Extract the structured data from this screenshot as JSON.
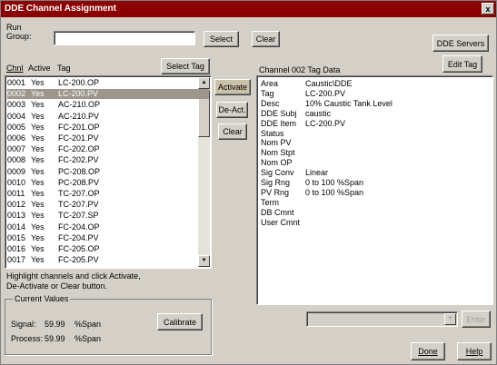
{
  "window": {
    "title": "DDE Channel Assignment",
    "close_glyph": "x"
  },
  "top": {
    "run_group_label_1": "Run",
    "run_group_label_2": "Group:",
    "run_group_value": "",
    "select_button": "Select",
    "clear_button": "Clear",
    "dde_servers_button": "DDE Servers",
    "edit_tag_button": "Edit Tag"
  },
  "channels": {
    "headers": {
      "chnl": "Chnl",
      "active": "Active",
      "tag": "Tag"
    },
    "select_tag_button": "Select Tag",
    "rows": [
      {
        "chnl": "0001",
        "active": "Yes",
        "tag": "LC-200.OP"
      },
      {
        "chnl": "0002",
        "active": "Yes",
        "tag": "LC-200.PV"
      },
      {
        "chnl": "0003",
        "active": "Yes",
        "tag": "AC-210.OP"
      },
      {
        "chnl": "0004",
        "active": "Yes",
        "tag": "AC-210.PV"
      },
      {
        "chnl": "0005",
        "active": "Yes",
        "tag": "FC-201.OP"
      },
      {
        "chnl": "0006",
        "active": "Yes",
        "tag": "FC-201.PV"
      },
      {
        "chnl": "0007",
        "active": "Yes",
        "tag": "FC-202.OP"
      },
      {
        "chnl": "0008",
        "active": "Yes",
        "tag": "FC-202.PV"
      },
      {
        "chnl": "0009",
        "active": "Yes",
        "tag": "PC-208.OP"
      },
      {
        "chnl": "0010",
        "active": "Yes",
        "tag": "PC-208.PV"
      },
      {
        "chnl": "0011",
        "active": "Yes",
        "tag": "TC-207.OP"
      },
      {
        "chnl": "0012",
        "active": "Yes",
        "tag": "TC-207.PV"
      },
      {
        "chnl": "0013",
        "active": "Yes",
        "tag": "TC-207.SP"
      },
      {
        "chnl": "0014",
        "active": "Yes",
        "tag": "FC-204.OP"
      },
      {
        "chnl": "0015",
        "active": "Yes",
        "tag": "FC-204.PV"
      },
      {
        "chnl": "0016",
        "active": "Yes",
        "tag": "FC-205.OP"
      },
      {
        "chnl": "0017",
        "active": "Yes",
        "tag": "FC-205.PV"
      }
    ],
    "selected_chnl": "0002",
    "hint_line_1": "Highlight channels and click Activate,",
    "hint_line_2": "De-Activate or Clear button."
  },
  "actions": {
    "activate": "Activate",
    "deactivate": "De-Act.",
    "clear": "Clear"
  },
  "current_values": {
    "title": "Current Values",
    "signal_label": "Signal:",
    "signal_value": "59.99",
    "signal_unit": "%Span",
    "process_label": "Process:",
    "process_value": "59.99",
    "process_unit": "%Span",
    "calibrate_button": "Calibrate"
  },
  "tag_data": {
    "title": "Channel 002 Tag Data",
    "fields": [
      {
        "key": "Area",
        "value": "Caustic\\DDE"
      },
      {
        "key": "Tag",
        "value": "LC-200.PV"
      },
      {
        "key": "Desc",
        "value": "10% Caustic Tank Level"
      },
      {
        "key": "DDE Subj",
        "value": "caustic"
      },
      {
        "key": "DDE Item",
        "value": "LC-200.PV"
      },
      {
        "key": "Status",
        "value": ""
      },
      {
        "key": "Nom PV",
        "value": ""
      },
      {
        "key": "Nom Stpt",
        "value": ""
      },
      {
        "key": "Nom OP",
        "value": ""
      },
      {
        "key": "Sig Conv",
        "value": "Linear"
      },
      {
        "key": "Sig Rng",
        "value": "0 to 100 %Span"
      },
      {
        "key": "PV Rng",
        "value": "0 to 100 %Span"
      },
      {
        "key": "Term",
        "value": ""
      },
      {
        "key": "DB Cmnt",
        "value": ""
      },
      {
        "key": "User Cmnt",
        "value": ""
      }
    ]
  },
  "bottom": {
    "dropdown_value": "",
    "enter_button": "Enter",
    "done_button": "Done",
    "help_button": "Help"
  },
  "icons": {
    "scroll_up": "arrow-up-icon",
    "scroll_down": "arrow-down-icon",
    "dropdown": "chevron-down-icon"
  }
}
